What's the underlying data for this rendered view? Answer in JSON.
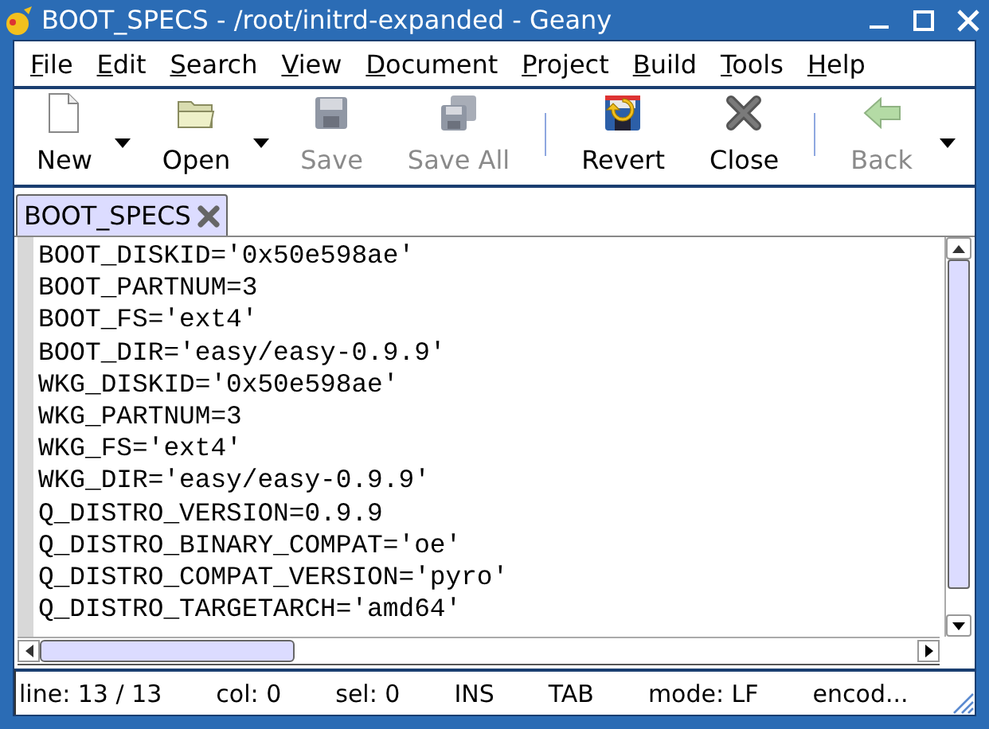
{
  "window": {
    "title": "BOOT_SPECS - /root/initrd-expanded - Geany"
  },
  "menu": [
    "File",
    "Edit",
    "Search",
    "View",
    "Document",
    "Project",
    "Build",
    "Tools",
    "Help"
  ],
  "toolbar": [
    {
      "label": "New",
      "disabled": false,
      "has_menu": true,
      "separator_after": false
    },
    {
      "label": "Open",
      "disabled": false,
      "has_menu": true,
      "separator_after": false
    },
    {
      "label": "Save",
      "disabled": true,
      "has_menu": false,
      "separator_after": false
    },
    {
      "label": "Save All",
      "disabled": true,
      "has_menu": false,
      "separator_after": true
    },
    {
      "label": "Revert",
      "disabled": false,
      "has_menu": false,
      "separator_after": false
    },
    {
      "label": "Close",
      "disabled": false,
      "has_menu": false,
      "separator_after": true
    },
    {
      "label": "Back",
      "disabled": true,
      "has_menu": false,
      "separator_after": false
    }
  ],
  "tabs": [
    {
      "label": "BOOT_SPECS",
      "selected": true
    }
  ],
  "editor": {
    "lines": [
      "BOOT_DISKID='0x50e598ae'",
      "BOOT_PARTNUM=3",
      "BOOT_FS='ext4'",
      "BOOT_DIR='easy/easy-0.9.9'",
      "WKG_DISKID='0x50e598ae'",
      "WKG_PARTNUM=3",
      "WKG_FS='ext4'",
      "WKG_DIR='easy/easy-0.9.9'",
      "Q_DISTRO_VERSION=0.9.9",
      "Q_DISTRO_BINARY_COMPAT='oe'",
      "Q_DISTRO_COMPAT_VERSION='pyro'",
      "Q_DISTRO_TARGETARCH='amd64'"
    ]
  },
  "status_bar": [
    "line: 13 / 13",
    "col: 0",
    "sel: 0",
    "INS",
    "TAB",
    "mode: LF",
    "encod..."
  ]
}
